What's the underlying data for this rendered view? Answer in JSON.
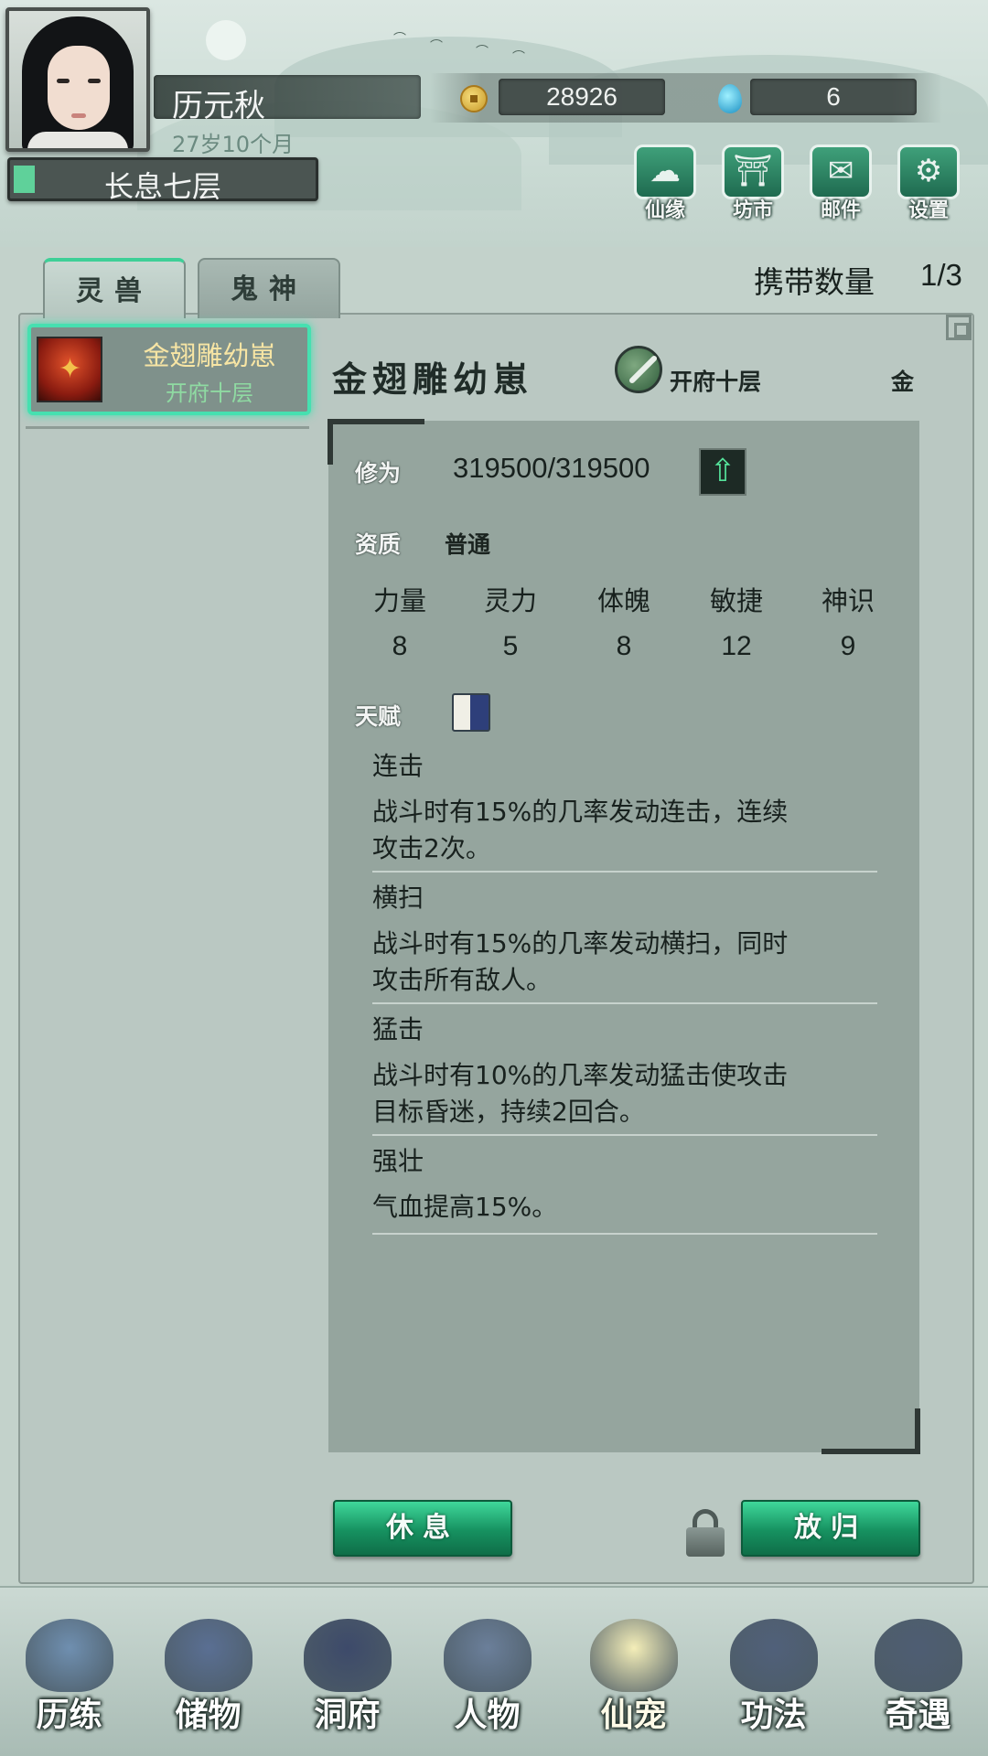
{
  "player": {
    "name": "历元秋",
    "age": "27岁10个月",
    "rank": "长息七层",
    "rank_progress": 0.07
  },
  "resources": {
    "coins": "28926",
    "gems": "6"
  },
  "top_buttons": [
    {
      "label": "仙缘",
      "icon": "cloud-icon"
    },
    {
      "label": "坊市",
      "icon": "market-icon"
    },
    {
      "label": "邮件",
      "icon": "mail-icon"
    },
    {
      "label": "设置",
      "icon": "gear-icon"
    }
  ],
  "tabs": [
    {
      "label": "灵兽",
      "active": true
    },
    {
      "label": "鬼神",
      "active": false
    }
  ],
  "carry": {
    "label": "携带数量",
    "value": "1/3"
  },
  "pet_list": [
    {
      "name": "金翅雕幼崽",
      "realm": "开府十层"
    }
  ],
  "detail": {
    "name": "金翅雕幼崽",
    "realm": "开府十层",
    "element": "金",
    "xiuwei_label": "修为",
    "xiuwei_value": "319500/319500",
    "quality_label": "资质",
    "quality_value": "普通",
    "stats": [
      {
        "name": "力量",
        "value": "8"
      },
      {
        "name": "灵力",
        "value": "5"
      },
      {
        "name": "体魄",
        "value": "8"
      },
      {
        "name": "敏捷",
        "value": "12"
      },
      {
        "name": "神识",
        "value": "9"
      }
    ],
    "talent_label": "天赋",
    "talents": [
      {
        "name": "连击",
        "desc": "战斗时有15%的几率发动连击，连续攻击2次。"
      },
      {
        "name": "横扫",
        "desc": "战斗时有15%的几率发动横扫，同时攻击所有敌人。"
      },
      {
        "name": "猛击",
        "desc": "战斗时有10%的几率发动猛击使攻击目标昏迷，持续2回合。"
      },
      {
        "name": "强壮",
        "desc": "气血提高15%。"
      }
    ]
  },
  "actions": {
    "rest": "休息",
    "release": "放归"
  },
  "bottom_nav": [
    {
      "label": "历练",
      "icon": "mountain-icon",
      "color": "#6f8fb0"
    },
    {
      "label": "储物",
      "icon": "bag-icon",
      "color": "#5a6f93"
    },
    {
      "label": "洞府",
      "icon": "pagoda-icon",
      "color": "#3d4a6a"
    },
    {
      "label": "人物",
      "icon": "person-icon",
      "color": "#6b7f9a"
    },
    {
      "label": "仙宠",
      "icon": "spirit-pet-icon",
      "color": "#f4eeb8",
      "active": true
    },
    {
      "label": "功法",
      "icon": "scroll-icon",
      "color": "#50607a"
    },
    {
      "label": "奇遇",
      "icon": "feather-icon",
      "color": "#4e5d73"
    }
  ]
}
